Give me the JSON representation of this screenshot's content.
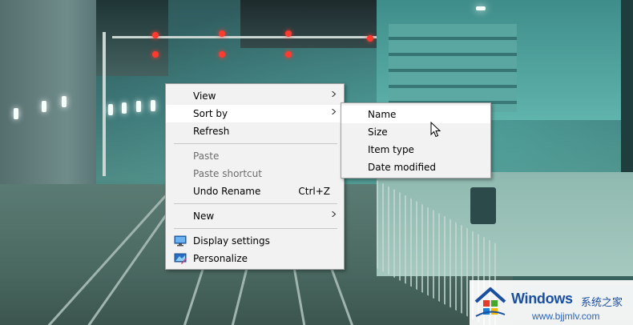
{
  "context_menu": {
    "items": [
      {
        "label": "View",
        "has_submenu": true
      },
      {
        "label": "Sort by",
        "has_submenu": true,
        "highlighted": true
      },
      {
        "label": "Refresh"
      },
      {
        "label": "Paste",
        "disabled": true
      },
      {
        "label": "Paste shortcut",
        "disabled": true
      },
      {
        "label": "Undo Rename",
        "shortcut": "Ctrl+Z"
      },
      {
        "label": "New",
        "has_submenu": true
      },
      {
        "label": "Display settings",
        "icon": "display-settings-icon"
      },
      {
        "label": "Personalize",
        "icon": "personalize-icon"
      }
    ]
  },
  "sort_submenu": {
    "items": [
      {
        "label": "Name",
        "highlighted": true
      },
      {
        "label": "Size"
      },
      {
        "label": "Item type"
      },
      {
        "label": "Date modified"
      }
    ]
  },
  "watermark": {
    "title": "Windows",
    "subtitle_cn": "系统之家",
    "url": "www.bjjmlv.com"
  },
  "colors": {
    "menu_bg": "#f2f2f2",
    "menu_hover": "#ffffff",
    "disabled_text": "#6d6d6d",
    "watermark_blue": "#1a4fa0"
  }
}
